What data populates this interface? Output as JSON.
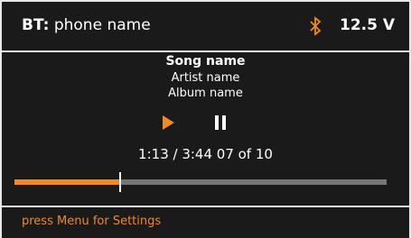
{
  "header": {
    "bt_label": "BT:",
    "device_name": "phone name",
    "bluetooth_icon": "bluetooth-icon",
    "voltage": "12.5 V"
  },
  "track": {
    "song": "Song name",
    "artist": "Artist name",
    "album": "Album name"
  },
  "controls": {
    "play_icon": "play-icon",
    "pause_icon": "pause-icon"
  },
  "playback": {
    "time_text": "1:13 / 3:44  07 of 10",
    "progress": 0.285
  },
  "footer": {
    "hint": "press Menu for Settings"
  },
  "colors": {
    "accent": "#f08a24",
    "background": "#1a1a1a",
    "border": "#e8e8e8",
    "track": "#767676"
  }
}
